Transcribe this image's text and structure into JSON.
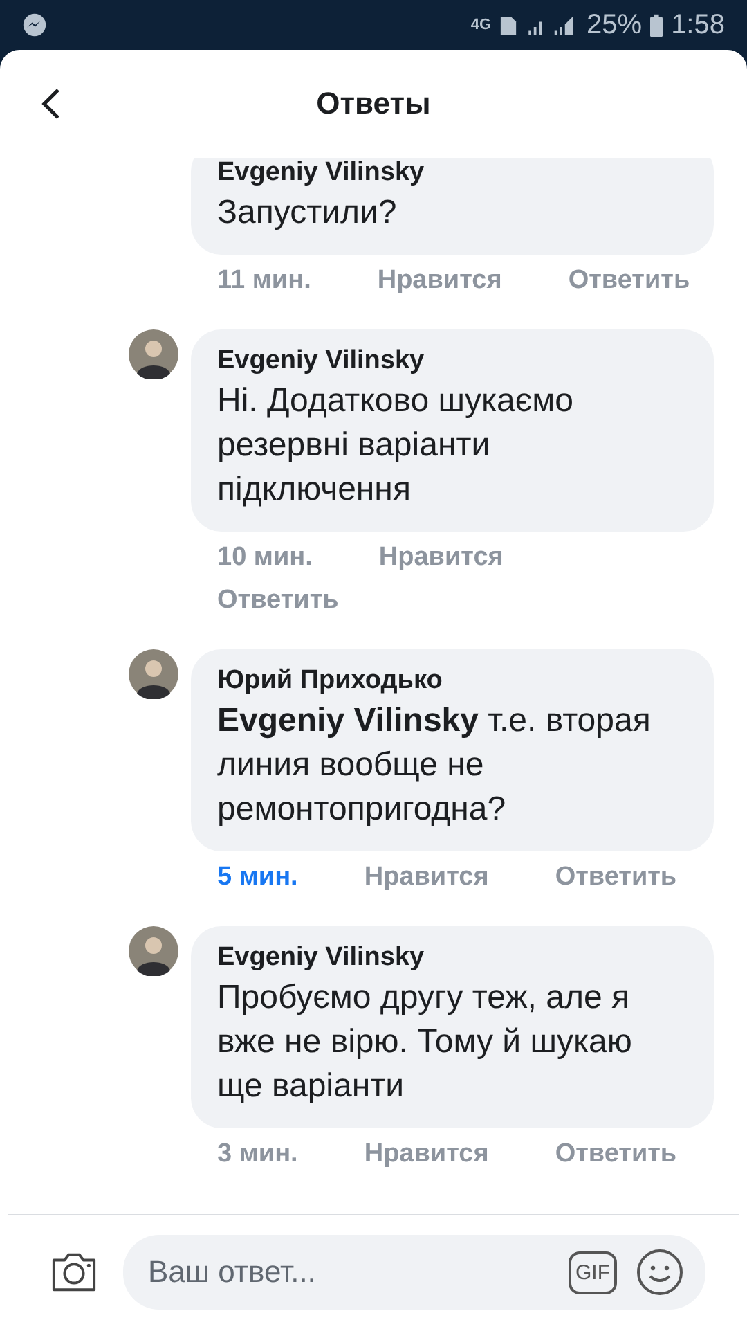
{
  "status_bar": {
    "battery": "25%",
    "time": "1:58",
    "network": "4G"
  },
  "header": {
    "title": "Ответы"
  },
  "comments": [
    {
      "author": "Evgeniy Vilinsky",
      "text": "Запустили?",
      "time": "11 мин.",
      "time_new": false,
      "like": "Нравится",
      "reply": "Ответить",
      "avatar": false
    },
    {
      "author": "Evgeniy Vilinsky",
      "text": "Ні. Додатково шукаємо резервні варіанти підключення",
      "time": "10 мин.",
      "time_new": false,
      "like": "Нравится",
      "reply": "Ответить",
      "avatar": true
    },
    {
      "author": "Юрий Приходько",
      "text": "**Evgeniy Vilinsky** т.е. вторая линия вообще не ремонтопригодна?",
      "time": "5 мин.",
      "time_new": true,
      "like": "Нравится",
      "reply": "Ответить",
      "avatar": true
    },
    {
      "author": "Evgeniy Vilinsky",
      "text": "Пробуємо другу теж, але я вже не вірю. Тому й шукаю ще варіанти",
      "time": "3 мин.",
      "time_new": false,
      "like": "Нравится",
      "reply": "Ответить",
      "avatar": true
    }
  ],
  "composer": {
    "placeholder": "Ваш ответ...",
    "gif": "GIF"
  }
}
